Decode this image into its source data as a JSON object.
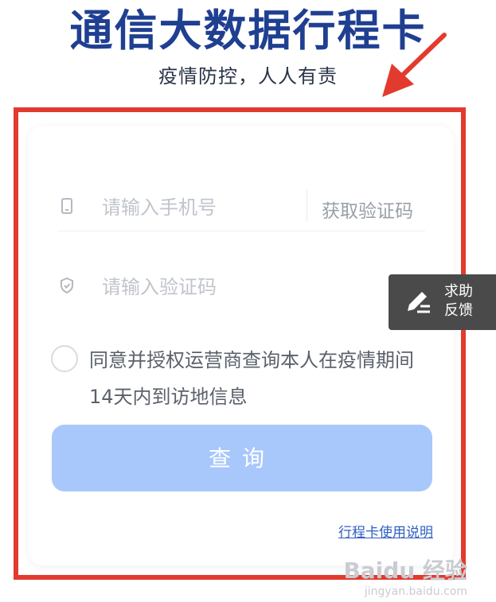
{
  "header": {
    "title": "通信大数据行程卡",
    "subtitle": "疫情防控，人人有责"
  },
  "form": {
    "phone_placeholder": "请输入手机号",
    "get_code_label": "获取验证码",
    "code_placeholder": "请输入验证码",
    "agreement_text": "同意并授权运营商查询本人在疫情期间14天内到访地信息",
    "agreement_checked": false,
    "query_button_label": "查询",
    "help_link_label": "行程卡使用说明"
  },
  "feedback_widget": {
    "label": "求助反馈"
  },
  "watermark": {
    "brand": "Baidu 经验",
    "url": "jingyan.baidu.com"
  },
  "colors": {
    "title": "#1f3f91",
    "highlight_frame": "#e33a2f",
    "query_button_bg": "#a8c8fb",
    "link": "#2e5fc2",
    "feedback_bg": "#4a4a4a"
  },
  "icons": {
    "phone_field": "phone-icon",
    "code_field": "shield-icon",
    "feedback": "edit-pen-icon",
    "annotation": "red-arrow-icon"
  }
}
